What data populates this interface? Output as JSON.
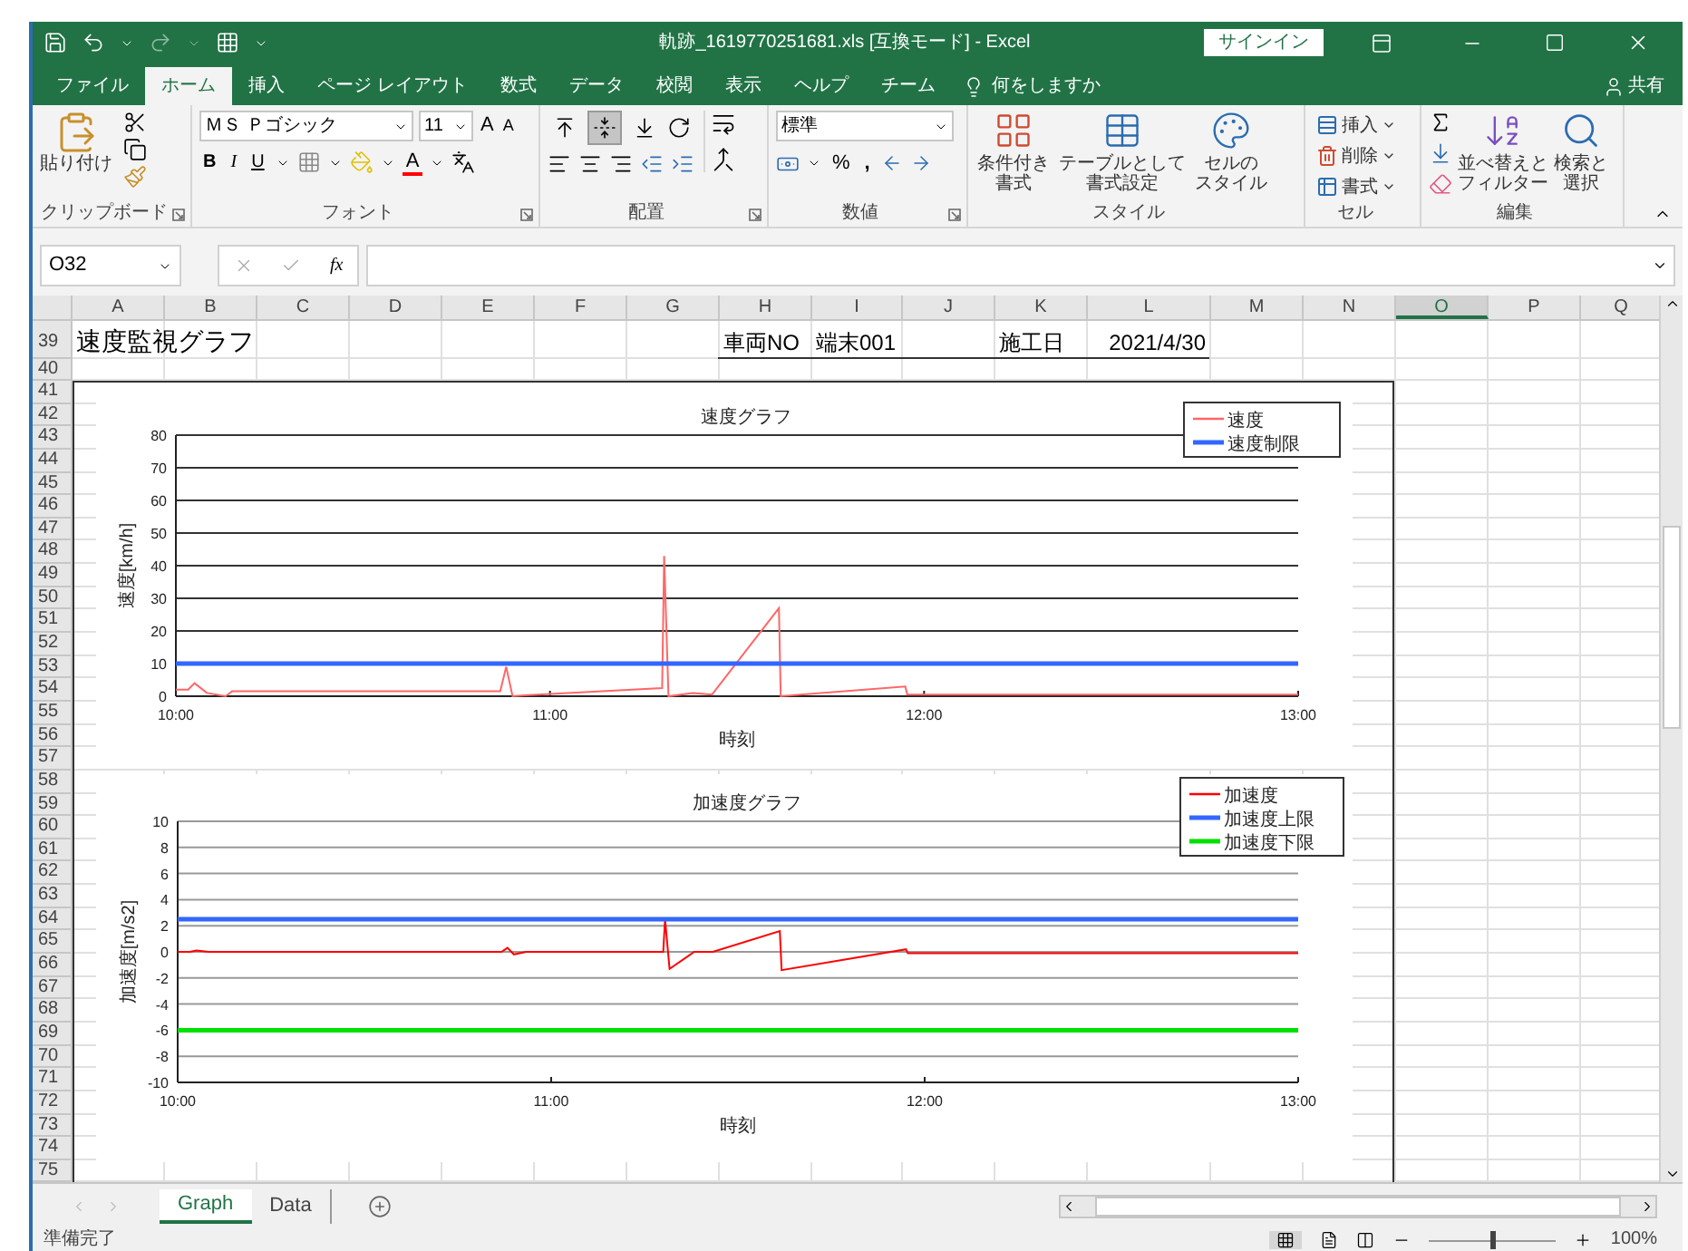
{
  "window": {
    "title": "軌跡_1619770251681.xls [互換モード] - Excel",
    "sign_in": "サインイン"
  },
  "ribbon_tabs": [
    {
      "label": "ファイル",
      "selected": false
    },
    {
      "label": "ホーム",
      "selected": true
    },
    {
      "label": "挿入",
      "selected": false
    },
    {
      "label": "ページ レイアウト",
      "selected": false
    },
    {
      "label": "数式",
      "selected": false
    },
    {
      "label": "データ",
      "selected": false
    },
    {
      "label": "校閲",
      "selected": false
    },
    {
      "label": "表示",
      "selected": false
    },
    {
      "label": "ヘルプ",
      "selected": false
    },
    {
      "label": "チーム",
      "selected": false
    }
  ],
  "tell_me": "何をしますか",
  "share": "共有",
  "clipboard": {
    "paste": "貼り付け",
    "label": "クリップボード"
  },
  "font": {
    "name": "ＭＳ Ｐゴシック",
    "size": "11",
    "grow": "A",
    "shrink": "A",
    "bold": "B",
    "italic": "I",
    "underline": "U",
    "font_color_button": "A",
    "label": "フォント"
  },
  "alignment": {
    "vertical": [
      {
        "selected": false
      },
      {
        "selected": true
      },
      {
        "selected": false
      }
    ],
    "label": "配置"
  },
  "number": {
    "format": "標準",
    "percent": "%",
    "comma": ",",
    "label": "数値"
  },
  "styles": {
    "buttons": [
      {
        "line1": "条件付き",
        "line2": "書式"
      },
      {
        "line1": "テーブルとして",
        "line2": "書式設定"
      },
      {
        "line1": "セルの",
        "line2": "スタイル"
      }
    ],
    "label": "スタイル"
  },
  "cells": {
    "buttons": [
      "挿入",
      "削除",
      "書式"
    ],
    "label": "セル"
  },
  "editing": {
    "buttons": [
      {
        "line1": "並べ替えと",
        "line2": "フィルター"
      },
      {
        "line1": "検索と",
        "line2": "選択"
      }
    ],
    "label": "編集"
  },
  "formula_bar": {
    "name_box": "O32",
    "function_symbol": "fx"
  },
  "columns": [
    {
      "label": "A",
      "selected": false
    },
    {
      "label": "B",
      "selected": false
    },
    {
      "label": "C",
      "selected": false
    },
    {
      "label": "D",
      "selected": false
    },
    {
      "label": "E",
      "selected": false
    },
    {
      "label": "F",
      "selected": false
    },
    {
      "label": "G",
      "selected": false
    },
    {
      "label": "H",
      "selected": false
    },
    {
      "label": "I",
      "selected": false
    },
    {
      "label": "J",
      "selected": false
    },
    {
      "label": "K",
      "selected": false
    },
    {
      "label": "L",
      "selected": false
    },
    {
      "label": "M",
      "selected": false
    },
    {
      "label": "N",
      "selected": false
    },
    {
      "label": "O",
      "selected": true
    },
    {
      "label": "P",
      "selected": false
    },
    {
      "label": "Q",
      "selected": false
    }
  ],
  "row_headers": [
    "39",
    "40",
    "41",
    "42",
    "43",
    "44",
    "45",
    "46",
    "47",
    "48",
    "49",
    "50",
    "51",
    "52",
    "53",
    "54",
    "55",
    "56",
    "57",
    "58",
    "59",
    "60",
    "61",
    "62",
    "63",
    "64",
    "65",
    "66",
    "67",
    "68",
    "69",
    "70",
    "71",
    "72",
    "73",
    "74",
    "75"
  ],
  "sheet_title": "速度監視グラフ",
  "header_cells": [
    {
      "text": "車両NO"
    },
    {
      "text": "端末001"
    },
    {
      "text": "施工日"
    },
    {
      "text": "2021/4/30"
    }
  ],
  "speed_chart": {
    "chart_data": {
      "type": "line",
      "title": "速度グラフ",
      "xlabel": "時刻",
      "ylabel": "速度[km/h]",
      "x": [
        10,
        10.033,
        10.05,
        10.083,
        10.133,
        10.15,
        10.867,
        10.883,
        10.9,
        10.933,
        11.3,
        11.305,
        11.317,
        11.383,
        11.433,
        11.612,
        11.617,
        11.95,
        11.955,
        13
      ],
      "series": [
        {
          "name": "速度",
          "color": "#ff6666",
          "values": [
            2,
            2,
            4,
            1,
            0,
            1.5,
            1.5,
            9,
            0,
            0.3,
            2.5,
            43,
            0,
            1,
            0.5,
            27,
            0,
            3,
            0.5,
            0.5
          ]
        },
        {
          "name": "速度制限",
          "color": "#3366ff",
          "values": [
            10,
            10,
            10,
            10,
            10,
            10,
            10,
            10,
            10,
            10,
            10,
            10,
            10,
            10,
            10,
            10,
            10,
            10,
            10,
            10
          ]
        }
      ],
      "xlim": [
        10,
        13
      ],
      "ylim": [
        0,
        80
      ],
      "xticks": [
        {
          "value": 10,
          "label": "10:00"
        },
        {
          "value": 11,
          "label": "11:00"
        },
        {
          "value": 12,
          "label": "12:00"
        },
        {
          "value": 13,
          "label": "13:00"
        }
      ],
      "yticks": [
        0,
        10,
        20,
        30,
        40,
        50,
        60,
        70,
        80
      ],
      "grid": true,
      "legend": true
    }
  },
  "accel_chart": {
    "chart_data": {
      "type": "line",
      "title": "加速度グラフ",
      "xlabel": "時刻",
      "ylabel": "加速度[m/s2]",
      "x": [
        10,
        10.033,
        10.05,
        10.083,
        10.133,
        10.15,
        10.867,
        10.883,
        10.9,
        10.933,
        11.3,
        11.305,
        11.317,
        11.383,
        11.433,
        11.612,
        11.617,
        11.95,
        11.955,
        13
      ],
      "series": [
        {
          "name": "加速度",
          "color": "#ff0000",
          "values": [
            0,
            0,
            0.1,
            0,
            0,
            0,
            0,
            0.3,
            -0.2,
            0,
            0,
            2.5,
            -1.3,
            0,
            0,
            1.6,
            -1.4,
            0.2,
            -0.1,
            -0.1
          ]
        },
        {
          "name": "加速度上限",
          "color": "#3366ff",
          "values": [
            2.5,
            2.5,
            2.5,
            2.5,
            2.5,
            2.5,
            2.5,
            2.5,
            2.5,
            2.5,
            2.5,
            2.5,
            2.5,
            2.5,
            2.5,
            2.5,
            2.5,
            2.5,
            2.5,
            2.5
          ]
        },
        {
          "name": "加速度下限",
          "color": "#00e000",
          "values": [
            -6,
            -6,
            -6,
            -6,
            -6,
            -6,
            -6,
            -6,
            -6,
            -6,
            -6,
            -6,
            -6,
            -6,
            -6,
            -6,
            -6,
            -6,
            -6,
            -6
          ]
        }
      ],
      "xlim": [
        10,
        13
      ],
      "ylim": [
        -10,
        10
      ],
      "xticks": [
        {
          "value": 10,
          "label": "10:00"
        },
        {
          "value": 11,
          "label": "11:00"
        },
        {
          "value": 12,
          "label": "12:00"
        },
        {
          "value": 13,
          "label": "13:00"
        }
      ],
      "yticks": [
        -10,
        -8,
        -6,
        -4,
        -2,
        0,
        2,
        4,
        6,
        8,
        10
      ],
      "grid": true,
      "legend": true
    }
  },
  "sheet_tabs": [
    {
      "label": "Graph",
      "selected": true
    },
    {
      "label": "Data",
      "selected": false
    }
  ],
  "status_bar": {
    "text": "準備完了",
    "zoom_slider": {
      "level": 0.5
    },
    "zoom": "100%"
  }
}
